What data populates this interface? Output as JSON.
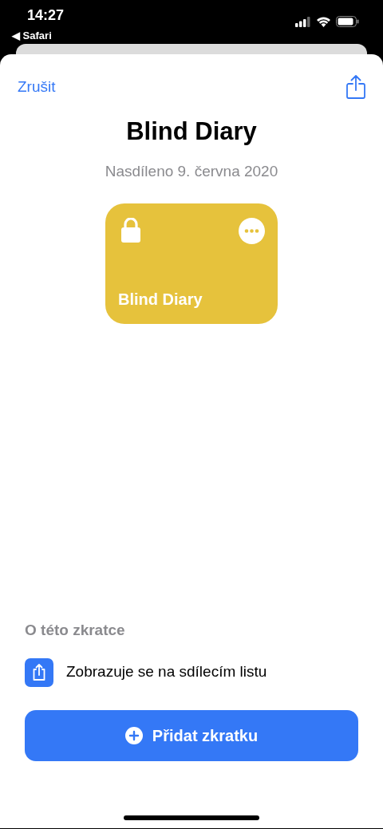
{
  "status_bar": {
    "time": "14:27",
    "back_app": "◀ Safari"
  },
  "header": {
    "cancel": "Zrušit"
  },
  "title": "Blind Diary",
  "subtitle": "Nasdíleno 9. června 2020",
  "shortcut_card": {
    "name": "Blind Diary",
    "color": "#e6c23c"
  },
  "about": {
    "heading": "O této zkratce",
    "items": [
      {
        "text": "Zobrazuje se na sdílecím listu"
      }
    ]
  },
  "add_button": {
    "label": "Přidat zkratku"
  }
}
